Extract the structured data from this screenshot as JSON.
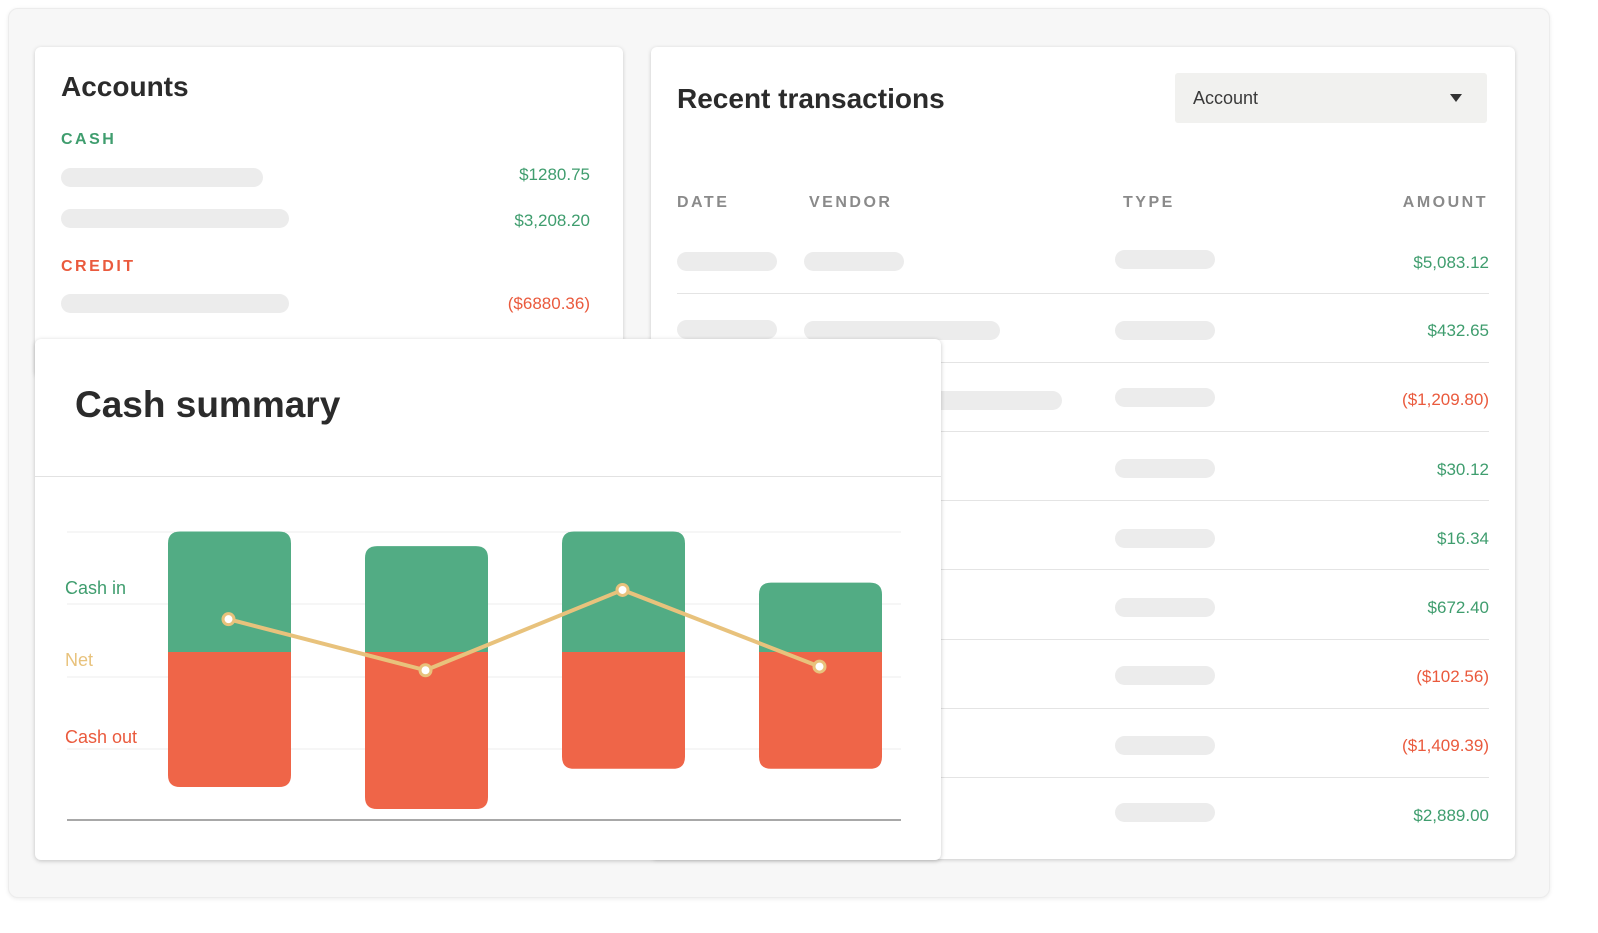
{
  "colors": {
    "positive": "#3f9d6e",
    "negative": "#ea5a3d",
    "cash_in_bar": "#52ac84",
    "cash_out_bar": "#ef6548",
    "net_line": "#e8c27c"
  },
  "accounts": {
    "title": "Accounts",
    "cash_label": "CASH",
    "cash_amounts": [
      "$1280.75",
      "$3,208.20"
    ],
    "credit_label": "CREDIT",
    "credit_amounts": [
      "($6880.36)"
    ]
  },
  "transactions": {
    "title": "Recent transactions",
    "filter": {
      "selected": "Account",
      "icon": "chevron-down-icon"
    },
    "columns": [
      "DATE",
      "VENDOR",
      "TYPE",
      "AMOUNT"
    ],
    "amounts": [
      "$5,083.12",
      "$432.65",
      "($1,209.80)",
      "$30.12",
      "$16.34",
      "$672.40",
      "($102.56)",
      "($1,409.39)",
      "$2,889.00"
    ]
  },
  "summary": {
    "title": "Cash summary",
    "chart_data": {
      "type": "bar",
      "legend_labels": [
        "Cash in",
        "Net",
        "Cash out"
      ],
      "series": [
        {
          "name": "Cash in",
          "values": [
            1.65,
            1.45,
            1.65,
            0.95
          ]
        },
        {
          "name": "Cash out",
          "values": [
            -1.85,
            -2.15,
            -1.6,
            -1.6
          ]
        },
        {
          "name": "Net",
          "values": [
            0.45,
            -0.25,
            0.85,
            -0.2
          ]
        }
      ],
      "grid": true
    }
  }
}
